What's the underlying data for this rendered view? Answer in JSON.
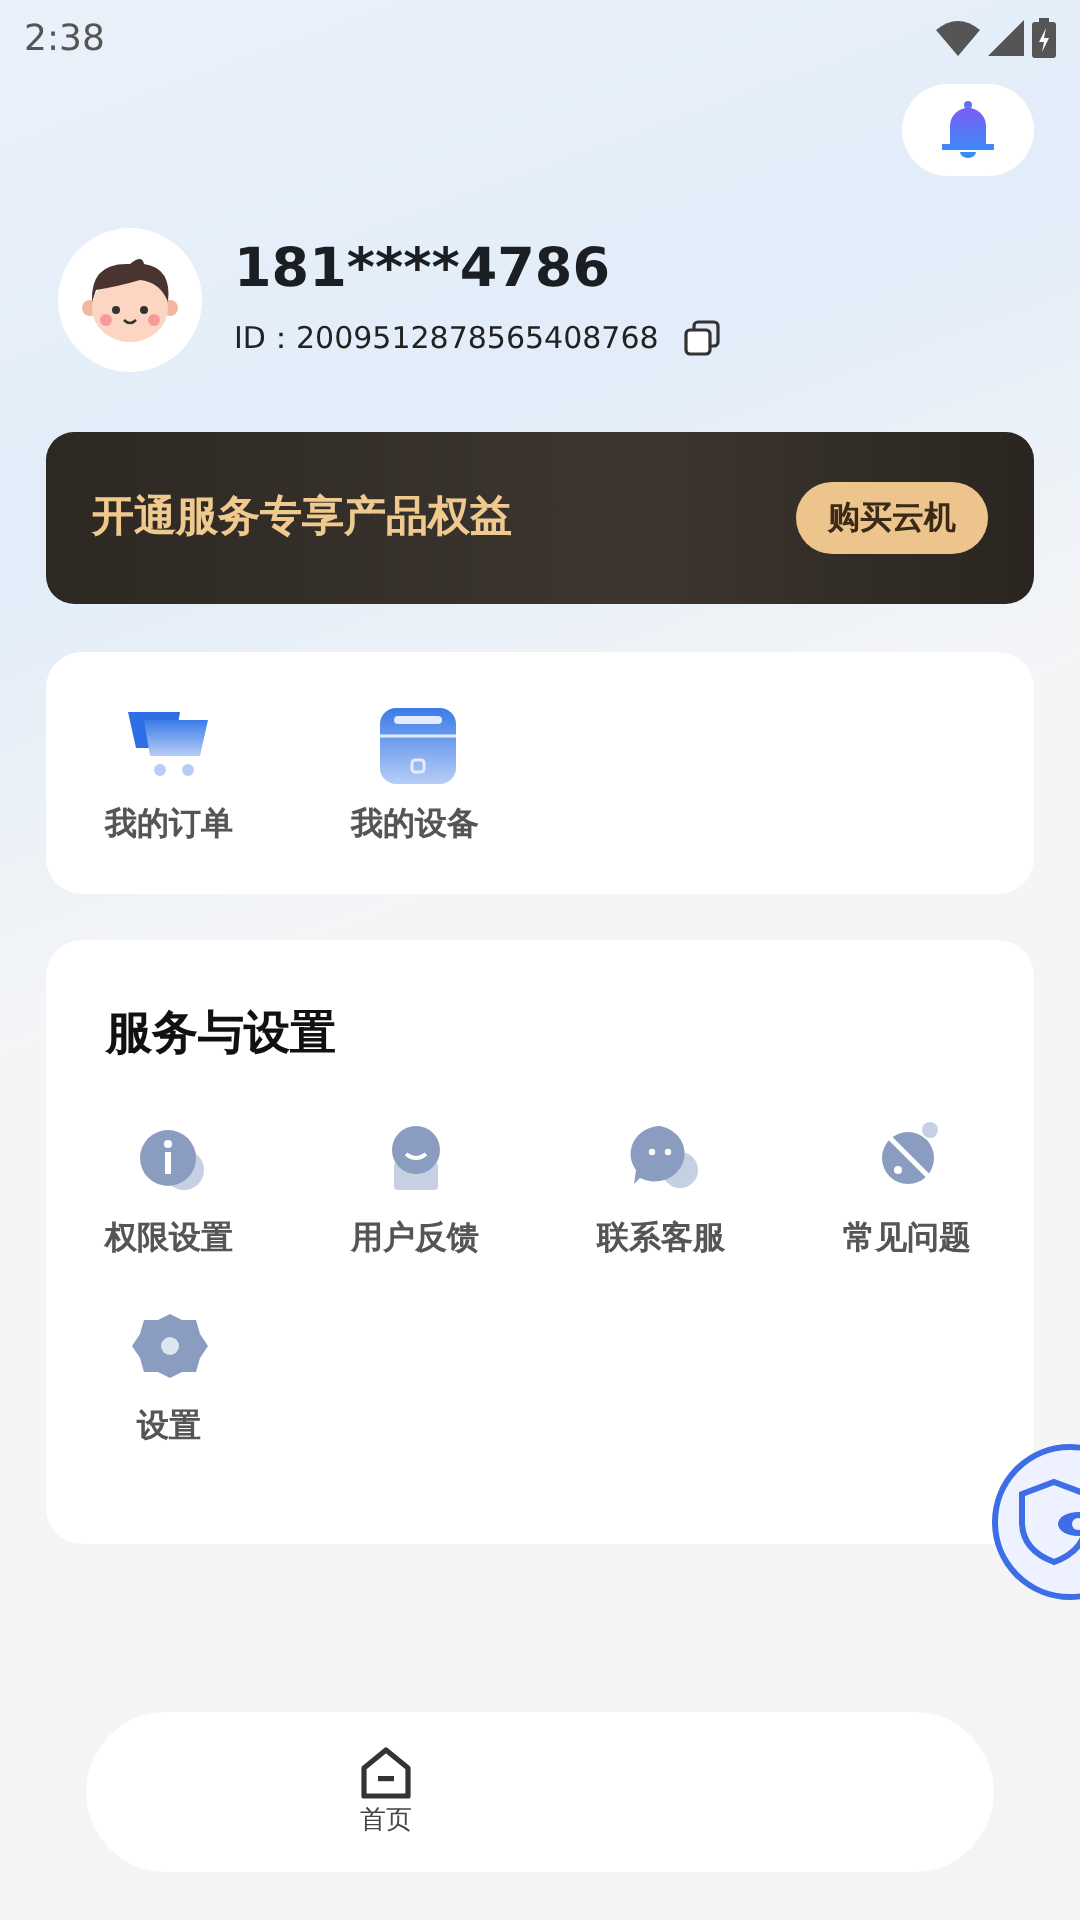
{
  "status_bar": {
    "time": "2:38"
  },
  "profile": {
    "phone": "181****4786",
    "id_label": "ID：",
    "id_value": "2009512878565408768"
  },
  "banner": {
    "title": "开通服务专享产品权益",
    "button": "购买云机"
  },
  "shortcuts": [
    {
      "kind": "cart",
      "label": "我的订单"
    },
    {
      "kind": "device",
      "label": "我的设备"
    }
  ],
  "services": {
    "title": "服务与设置",
    "items": [
      {
        "kind": "info",
        "label": "权限设置"
      },
      {
        "kind": "feedback",
        "label": "用户反馈"
      },
      {
        "kind": "chat",
        "label": "联系客服"
      },
      {
        "kind": "faq",
        "label": "常见问题"
      },
      {
        "kind": "gear",
        "label": "设置"
      }
    ]
  },
  "bottom_nav": [
    {
      "kind": "home",
      "label": "首页"
    }
  ]
}
